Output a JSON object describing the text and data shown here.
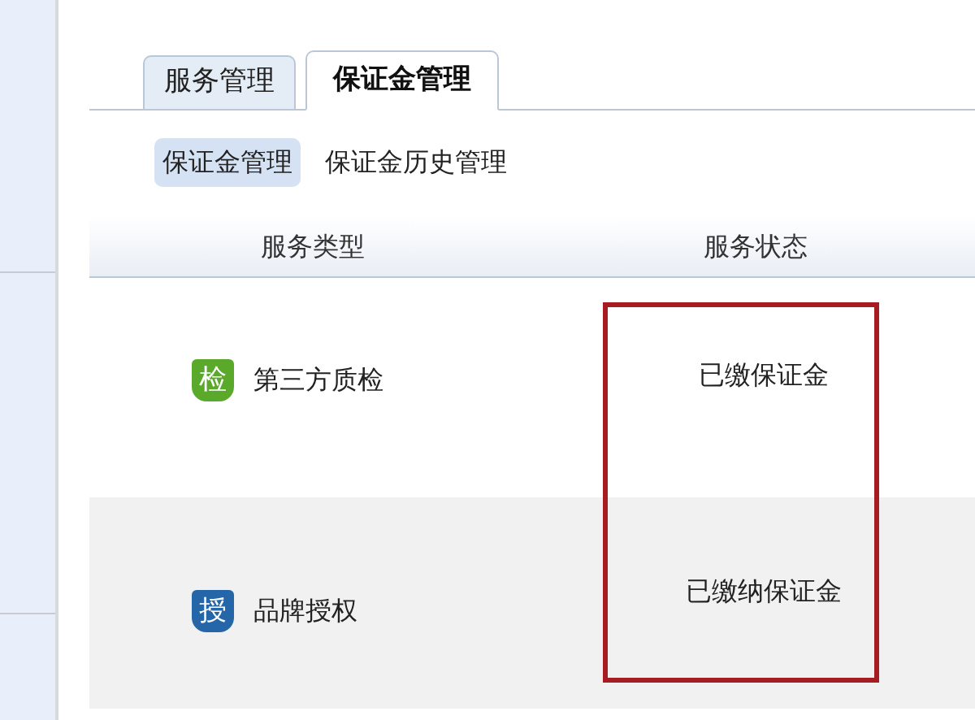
{
  "tabs": [
    {
      "label": "服务管理",
      "selected": false
    },
    {
      "label": "保证金管理",
      "selected": true
    }
  ],
  "subtabs": [
    {
      "label": "保证金管理",
      "selected": true
    },
    {
      "label": "保证金历史管理",
      "selected": false
    }
  ],
  "table": {
    "columns": [
      "服务类型",
      "服务状态"
    ],
    "rows": [
      {
        "badge": "检",
        "color": "#5aa92a",
        "service": "第三方质检",
        "status": "已缴保证金"
      },
      {
        "badge": "授",
        "color": "#2566a8",
        "service": "品牌授权",
        "status": "已缴纳保证金"
      }
    ]
  }
}
